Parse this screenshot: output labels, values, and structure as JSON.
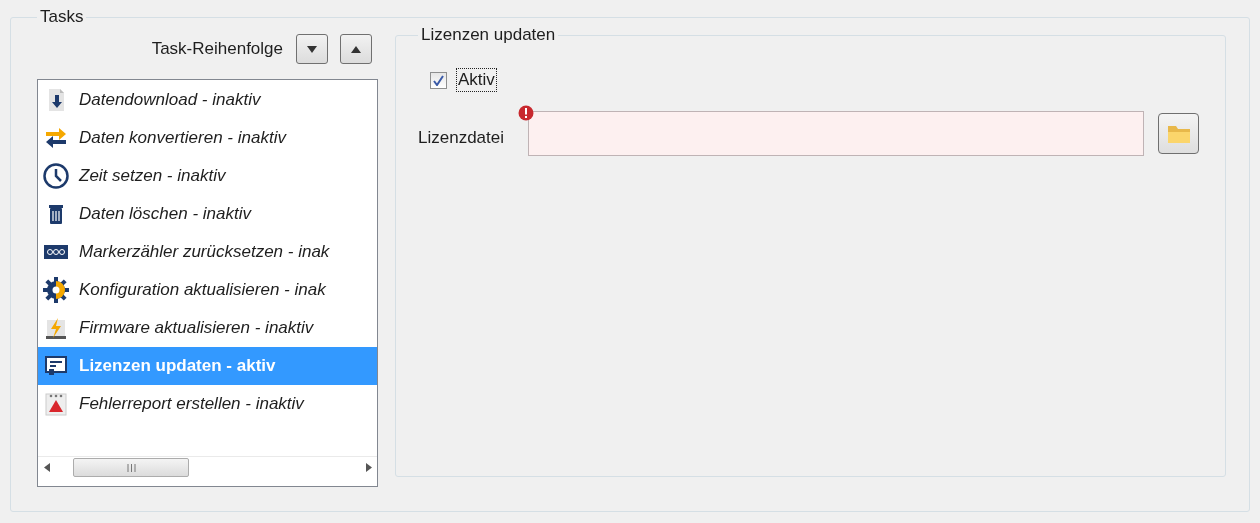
{
  "tasks_group": {
    "title": "Tasks"
  },
  "order": {
    "label": "Task-Reihenfolge",
    "buttons": [
      {
        "kind": "down"
      },
      {
        "kind": "up"
      }
    ]
  },
  "task_list": {
    "items": [
      {
        "kind": "download",
        "label": "Datendownload - inaktiv",
        "active": false,
        "selected": false
      },
      {
        "kind": "convert",
        "label": "Daten konvertieren - inaktiv",
        "active": false,
        "selected": false
      },
      {
        "kind": "clock",
        "label": "Zeit setzen - inaktiv",
        "active": false,
        "selected": false
      },
      {
        "kind": "trash",
        "label": "Daten löschen - inaktiv",
        "active": false,
        "selected": false
      },
      {
        "kind": "counter",
        "label": "Markerzähler zurücksetzen - inak",
        "active": false,
        "selected": false
      },
      {
        "kind": "gear",
        "label": "Konfiguration aktualisieren - inak",
        "active": false,
        "selected": false
      },
      {
        "kind": "firmware",
        "label": "Firmware aktualisieren - inaktiv",
        "active": false,
        "selected": false
      },
      {
        "kind": "license",
        "label": "Lizenzen updaten - aktiv",
        "active": true,
        "selected": true
      },
      {
        "kind": "report",
        "label": "Fehlerreport erstellen - inaktiv",
        "active": false,
        "selected": false
      }
    ]
  },
  "detail": {
    "title": "Lizenzen updaten",
    "active_checkbox": {
      "label": "Aktiv",
      "checked": true,
      "focused": true
    },
    "license_file": {
      "label": "Lizenzdatei",
      "error": true
    }
  }
}
